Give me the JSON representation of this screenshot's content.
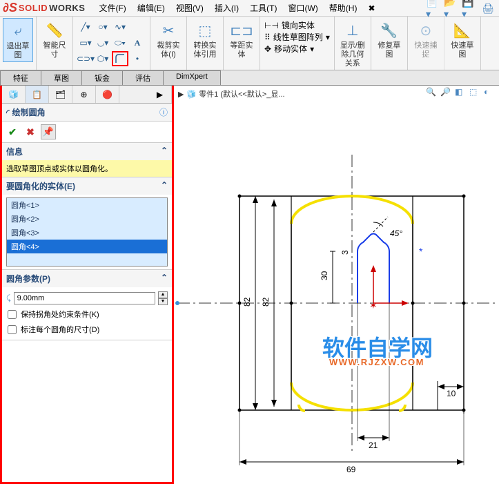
{
  "app": {
    "logo1": "SOLID",
    "logo2": "WORKS"
  },
  "menu": {
    "file": "文件(F)",
    "edit": "编辑(E)",
    "view": "视图(V)",
    "insert": "插入(I)",
    "tools": "工具(T)",
    "window": "窗口(W)",
    "help": "帮助(H)"
  },
  "ribbon": {
    "exit_sketch": "退出草图",
    "smart_dim": "智能尺寸",
    "trim": "裁剪实体(I)",
    "convert": "转换实体引用",
    "offset": "等距实体",
    "mirror": "镜向实体",
    "linear_pattern": "线性草图阵列",
    "move": "移动实体",
    "display_rel": "显示/删除几何关系",
    "repair": "修复草图",
    "quick_snap": "快速捕捉",
    "quick_sketch": "快速草图"
  },
  "tabs": {
    "feature": "特征",
    "sketch": "草图",
    "sheetmetal": "钣金",
    "evaluate": "评估",
    "dimxpert": "DimXpert"
  },
  "breadcrumb": {
    "part": "零件1 (默认<<默认>_显..."
  },
  "prop": {
    "title": "绘制圆角",
    "info_head": "信息",
    "info_text": "选取草图顶点或实体以圆角化。",
    "entities_head": "要圆角化的实体(E)",
    "entities": [
      "圆角<1>",
      "圆角<2>",
      "圆角<3>",
      "圆角<4>"
    ],
    "params_head": "圆角参数(P)",
    "radius": "9.00mm",
    "keep_constraints": "保持拐角处约束条件(K)",
    "label_each": "标注每个圆角的尺寸(D)"
  },
  "dims": {
    "angle": "45°",
    "d1": "3",
    "d2": "30",
    "d3": "82",
    "d4": "82",
    "d5": "10",
    "d6": "21",
    "d7": "69"
  },
  "watermark": {
    "main": "软件自学网",
    "sub": "WWW.RJZXW.COM"
  }
}
